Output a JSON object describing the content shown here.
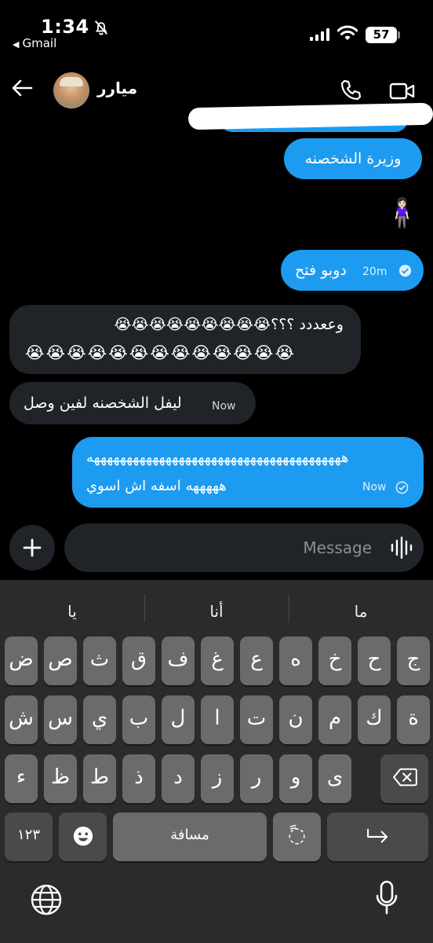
{
  "status_bar": {
    "time": "1:34",
    "back_app": "Gmail",
    "battery": "57"
  },
  "header": {
    "contact_name": "ميارر"
  },
  "messages": [
    {
      "dir": "out",
      "text": "وزيرة الشخصنه"
    },
    {
      "dir": "out",
      "text": "🧍🏻‍♀️"
    },
    {
      "dir": "out",
      "text": "دوبو فتح",
      "time": "20m"
    },
    {
      "dir": "in",
      "line1": "وععددد ؟؟؟😭😭😭😭😭😭😭😭😭",
      "line2": "😭😭😭😭😭😭😭😭😭😭😭😭😭"
    },
    {
      "dir": "in",
      "text": "ليفل الشخصنه لفين وصل",
      "time": "Now"
    },
    {
      "dir": "out",
      "line1": "هههههههههههههههههههههههههههههههههههههههه",
      "line2": "هههههه اسفه اش اسوي",
      "time": "Now"
    }
  ],
  "composer": {
    "placeholder": "Message"
  },
  "keyboard": {
    "suggestions": [
      "يا",
      "أنا",
      "ما"
    ],
    "row1": [
      "ض",
      "ص",
      "ث",
      "ق",
      "ف",
      "غ",
      "ع",
      "ه",
      "خ",
      "ح",
      "ج"
    ],
    "row2": [
      "ش",
      "س",
      "ي",
      "ب",
      "ل",
      "ا",
      "ت",
      "ن",
      "م",
      "ك",
      "ة"
    ],
    "row3": [
      "ء",
      "ظ",
      "ط",
      "ذ",
      "د",
      "ز",
      "ر",
      "و",
      "ى"
    ],
    "numbers_key": "١٢٣",
    "space_key": "مسافة",
    "diacritic_key": "◌ً"
  },
  "colors": {
    "outgoing_bubble": "#1d9bf0",
    "incoming_bubble": "#202327",
    "background": "#000000",
    "keyboard_bg": "#2b2b2b"
  },
  "icons": [
    "bell-slash-icon",
    "signal-icon",
    "wifi-icon",
    "back-arrow-icon",
    "phone-icon",
    "video-icon",
    "plus-icon",
    "voice-icon",
    "check-icon",
    "emoji-icon",
    "return-icon",
    "delete-icon",
    "globe-icon",
    "mic-icon"
  ]
}
